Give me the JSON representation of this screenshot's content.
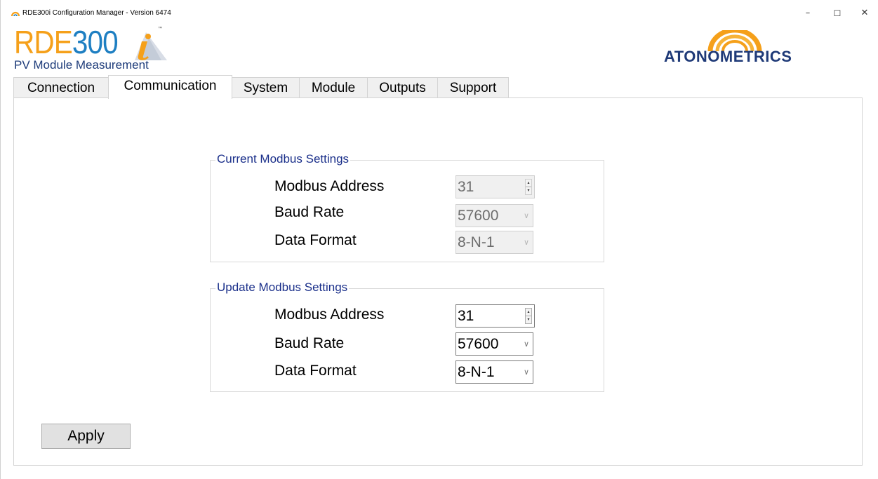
{
  "window": {
    "title": "RDE300i Configuration Manager - Version 6474",
    "minimize_glyph": "–",
    "maximize_glyph": "☐",
    "close_glyph": "✕"
  },
  "logo": {
    "product_prefix": "RDE",
    "product_number": "300",
    "trademark": "™",
    "subtitle": "PV Module Measurement",
    "brand_name": "ATONOMETRICS",
    "colors": {
      "orange": "#f5a01a",
      "blue": "#1e7fc2",
      "navy": "#1f3a78"
    }
  },
  "tabs": [
    {
      "label": "Connection",
      "active": false
    },
    {
      "label": "Communication",
      "active": true
    },
    {
      "label": "System",
      "active": false
    },
    {
      "label": "Module",
      "active": false
    },
    {
      "label": "Outputs",
      "active": false
    },
    {
      "label": "Support",
      "active": false
    }
  ],
  "current_settings": {
    "title": "Current Modbus Settings",
    "modbus_address_label": "Modbus Address",
    "modbus_address_value": "31",
    "baud_rate_label": "Baud Rate",
    "baud_rate_value": "57600",
    "data_format_label": "Data Format",
    "data_format_value": "8-N-1"
  },
  "update_settings": {
    "title": "Update Modbus Settings",
    "modbus_address_label": "Modbus Address",
    "modbus_address_value": "31",
    "baud_rate_label": "Baud Rate",
    "baud_rate_value": "57600",
    "data_format_label": "Data Format",
    "data_format_value": "8-N-1"
  },
  "apply_label": "Apply",
  "icons": {
    "spin_up": "▴",
    "spin_down": "▾",
    "dropdown": "∨"
  }
}
